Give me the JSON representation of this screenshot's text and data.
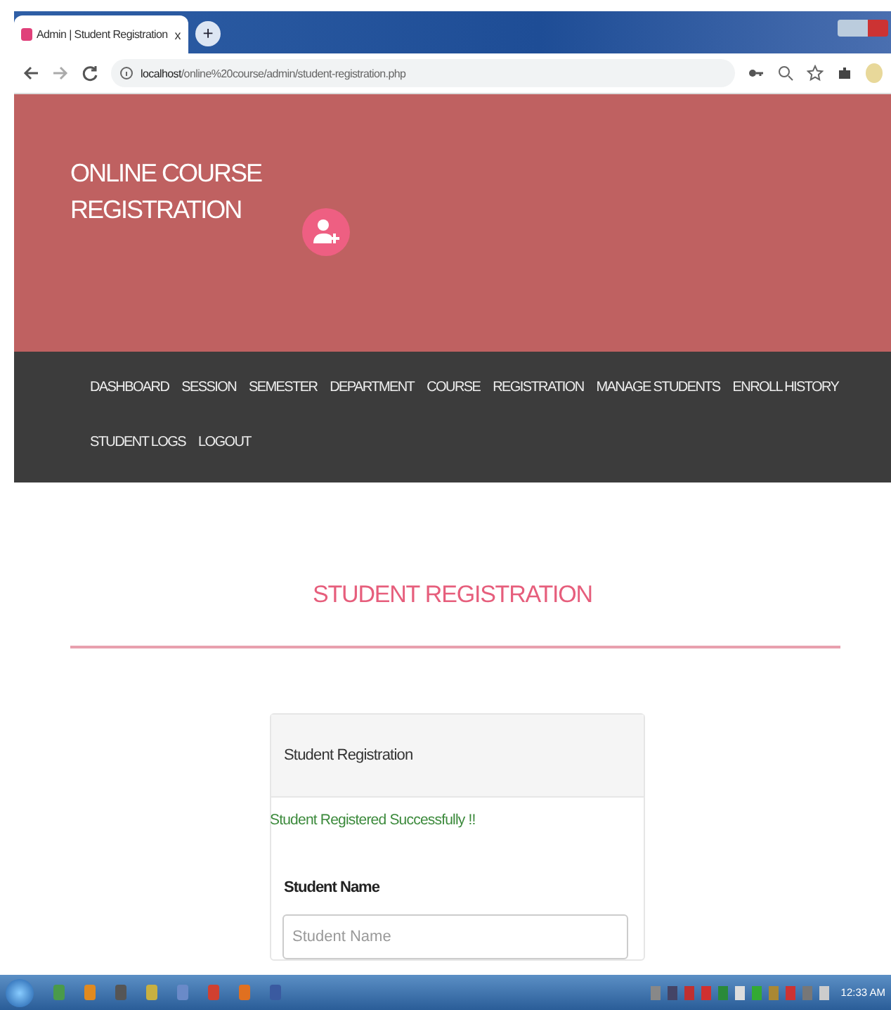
{
  "browser": {
    "tab_title": "Admin | Student Registration",
    "tab_close": "x",
    "new_tab": "+",
    "url_host": "localhost",
    "url_path": "/online%20course/admin/student-registration.php"
  },
  "header": {
    "title": "ONLINE COURSE REGISTRATION"
  },
  "nav": [
    {
      "label": "DASHBOARD"
    },
    {
      "label": "SESSION"
    },
    {
      "label": "SEMESTER"
    },
    {
      "label": "DEPARTMENT"
    },
    {
      "label": "COURSE"
    },
    {
      "label": "REGISTRATION"
    },
    {
      "label": "MANAGE STUDENTS"
    },
    {
      "label": "ENROLL HISTORY"
    },
    {
      "label": "STUDENT LOGS"
    },
    {
      "label": "LOGOUT"
    }
  ],
  "page_title": "STUDENT REGISTRATION",
  "panel": {
    "heading": "Student Registration",
    "message": "Student Registered Successfully !!",
    "fields": [
      {
        "label": "Student Name",
        "placeholder": "Student Name"
      }
    ]
  },
  "taskbar": {
    "clock": "12:33 AM"
  }
}
